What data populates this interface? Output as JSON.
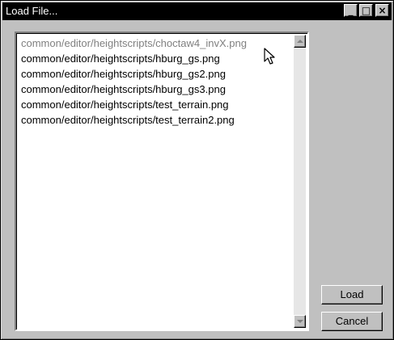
{
  "window": {
    "title": "Load File...",
    "controls": {
      "minimize": "_",
      "maximize": "□",
      "close": "×"
    }
  },
  "file_list": {
    "items": [
      "common/editor/heightscripts/choctaw4_invX.png",
      "common/editor/heightscripts/hburg_gs.png",
      "common/editor/heightscripts/hburg_gs2.png",
      "common/editor/heightscripts/hburg_gs3.png",
      "common/editor/heightscripts/test_terrain.png",
      "common/editor/heightscripts/test_terrain2.png"
    ],
    "selected_index": 0
  },
  "buttons": {
    "load": "Load",
    "cancel": "Cancel"
  },
  "icons": {
    "cursor": "arrow-cursor-icon",
    "scroll_up": "scroll-up-arrow-icon",
    "scroll_down": "scroll-down-arrow-icon"
  },
  "colors": {
    "window_bg": "#c0c0c0",
    "titlebar_bg": "#000000",
    "titlebar_text": "#ffffff",
    "list_bg": "#ffffff",
    "selected_text": "#808080"
  }
}
